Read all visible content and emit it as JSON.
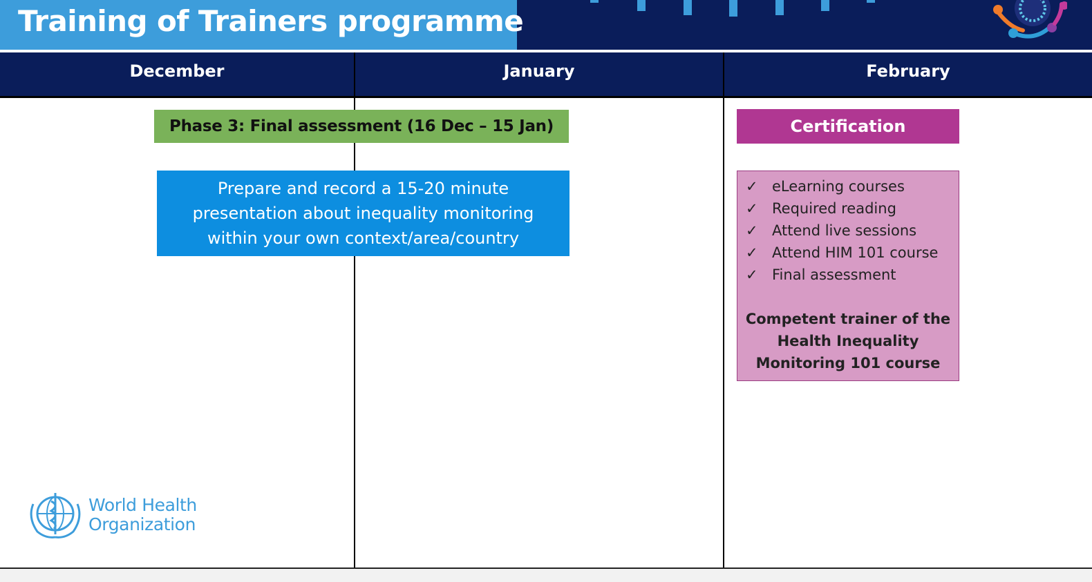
{
  "header": {
    "title": "Training of Trainers programme",
    "colors": {
      "banner_light": "#3d9ddb",
      "banner_dark": "#0a1d5a"
    }
  },
  "timeline": {
    "months": [
      "December",
      "January",
      "February"
    ]
  },
  "phase": {
    "label": "Phase 3: Final assessment (16 Dec – 15 Jan)",
    "color": "#7ab259"
  },
  "task": {
    "lines": [
      "Prepare and record a 15-20 minute",
      "presentation about inequality monitoring",
      "within your own context/area/country"
    ],
    "color": "#0d8ee0"
  },
  "certification": {
    "heading": "Certification",
    "heading_color": "#b03792",
    "box_color": "#d79bc5",
    "check_icon": "checkmark-icon",
    "check_glyph": "✓",
    "checklist": [
      "eLearning courses",
      "Required reading",
      "Attend live sessions",
      "Attend HIM 101 course",
      "Final assessment"
    ],
    "outcome_lines": [
      "Competent trainer of the",
      "Health Inequality",
      "Monitoring 101 course"
    ]
  },
  "who_logo": {
    "line1": "World Health",
    "line2": "Organization",
    "icon": "who-emblem-icon",
    "color": "#3d9ddb"
  }
}
